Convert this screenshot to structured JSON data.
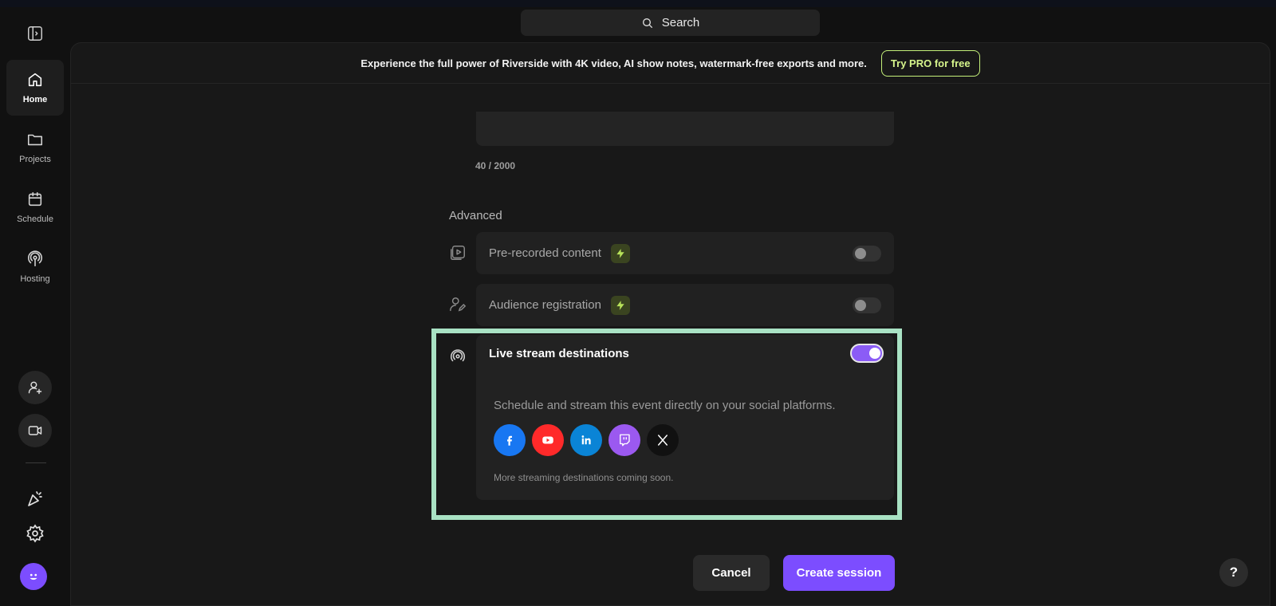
{
  "search": {
    "label": "Search",
    "icon": "search-icon"
  },
  "sidebar": {
    "items": [
      {
        "label": "Home",
        "icon": "home-icon",
        "active": true
      },
      {
        "label": "Projects",
        "icon": "folder-icon",
        "active": false
      },
      {
        "label": "Schedule",
        "icon": "calendar-icon",
        "active": false
      },
      {
        "label": "Hosting",
        "icon": "podcast-icon",
        "active": false
      }
    ]
  },
  "promo": {
    "text": "Experience the full power of Riverside with 4K video, AI show notes, watermark-free exports and more.",
    "button": "Try PRO for free"
  },
  "description": {
    "char_count": "40 / 2000"
  },
  "advanced": {
    "title": "Advanced",
    "pre_recorded": {
      "label": "Pre-recorded content",
      "enabled": false
    },
    "audience_registration": {
      "label": "Audience registration",
      "enabled": false
    },
    "live_stream": {
      "label": "Live stream destinations",
      "enabled": true,
      "description": "Schedule and stream this event directly on your social platforms.",
      "platforms": [
        "facebook",
        "youtube",
        "linkedin",
        "twitch",
        "x"
      ],
      "footer": "More streaming destinations coming soon."
    }
  },
  "actions": {
    "cancel": "Cancel",
    "create": "Create session"
  },
  "help": {
    "label": "?"
  },
  "colors": {
    "accent": "#7c4dff",
    "pro_green": "#c4f07a",
    "highlight": "#a9e2c4",
    "facebook": "#1877f2",
    "youtube": "#ff0000",
    "linkedin": "#0a66c2",
    "twitch": "#9146ff",
    "x": "#111111"
  }
}
